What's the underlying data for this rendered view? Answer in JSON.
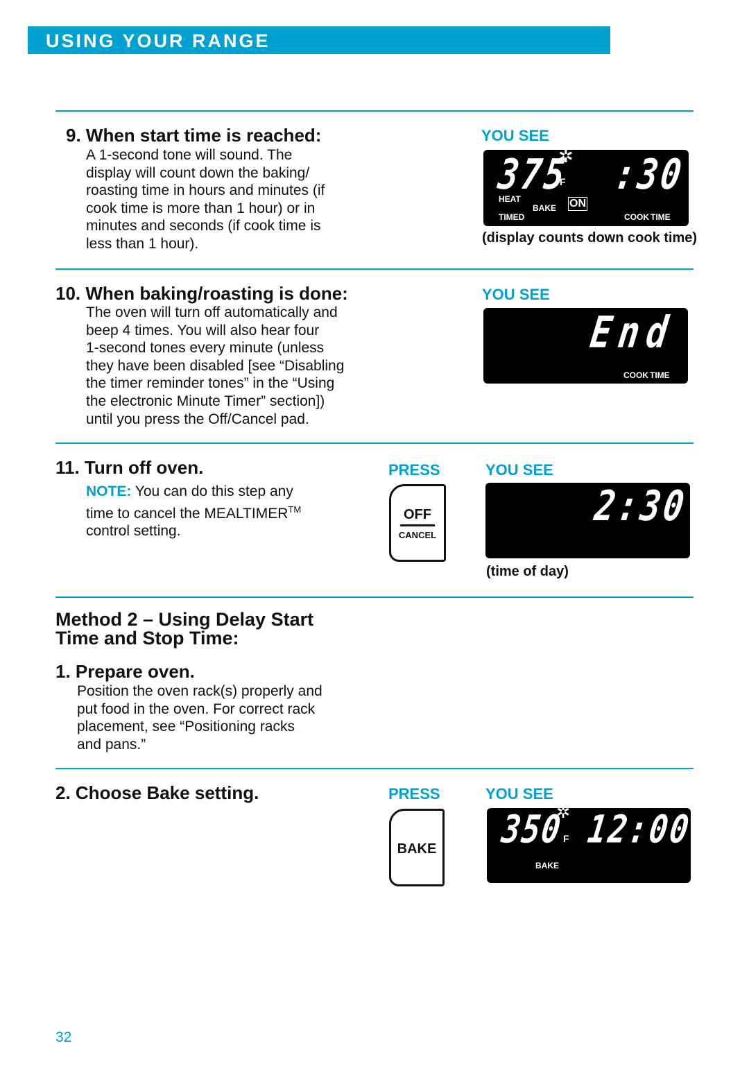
{
  "header": {
    "title": "USING YOUR RANGE"
  },
  "step9": {
    "title": "9. When start time is reached:",
    "body": [
      "A 1-second tone will sound. The",
      "display will count down the baking/",
      "roasting time in hours and minutes (if",
      "cook time is more than 1 hour) or in",
      "minutes and seconds (if cook time is",
      "less than 1 hour)."
    ],
    "you_see": "YOU SEE",
    "display": {
      "temp": "375",
      "unit": "F",
      "time": ":30",
      "labels": [
        "HEAT",
        "TIMED",
        "BAKE",
        "ON",
        "COOK",
        "TIME"
      ]
    },
    "caption": "(display counts down cook time)"
  },
  "step10": {
    "title": "10. When baking/roasting is done:",
    "body": [
      "The oven will turn off automatically and",
      "beep 4 times. You will also hear four",
      "1-second tones every minute (unless",
      "they have been disabled [see “Disabling",
      "the timer reminder tones” in the “Using",
      "the electronic Minute Timer” section])",
      "until you press the Off/Cancel pad."
    ],
    "you_see": "YOU SEE",
    "display": {
      "text": "End",
      "labels": [
        "COOK",
        "TIME"
      ]
    }
  },
  "step11": {
    "title": "11. Turn off oven.",
    "note_label": "NOTE:",
    "note": [
      " You can do this step any",
      "time to cancel the MEALTIMER",
      "control setting."
    ],
    "tm": "TM",
    "press": "PRESS",
    "button": {
      "line1": "OFF",
      "line2": "CANCEL"
    },
    "you_see": "YOU SEE",
    "display": {
      "time": "2:30"
    },
    "caption": "(time of day)"
  },
  "method2": {
    "title": [
      "Method 2 – Using Delay Start",
      "Time and Stop Time:"
    ]
  },
  "m2step1": {
    "title": "1. Prepare oven.",
    "body": [
      "Position the oven rack(s) properly and",
      "put food in the oven. For correct rack",
      "placement, see “Positioning racks",
      "and pans.”"
    ]
  },
  "m2step2": {
    "title": "2. Choose Bake setting.",
    "press": "PRESS",
    "button": "BAKE",
    "you_see": "YOU SEE",
    "display": {
      "temp": "350",
      "unit": "F",
      "time": "12:00",
      "label": "BAKE"
    }
  },
  "page_number": "32",
  "colors": {
    "accent": "#00a0d0"
  }
}
